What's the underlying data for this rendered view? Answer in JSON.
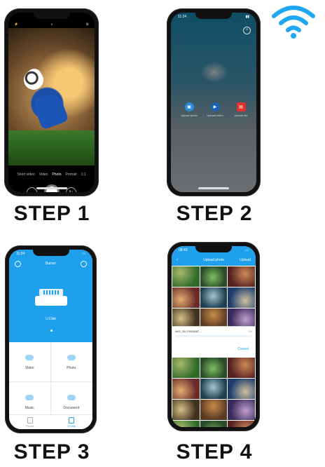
{
  "steps": [
    "STEP 1",
    "STEP 2",
    "STEP 3",
    "STEP 4"
  ],
  "wifi_icon": "wifi-icon",
  "colors": {
    "accent": "#1fa0ec",
    "wifi": "#1ea7f2"
  },
  "step1": {
    "camera_modes": [
      "Short video",
      "Video",
      "Photo",
      "Portrait",
      "1:1"
    ],
    "active_mode": "Photo"
  },
  "step2": {
    "time": "11:24",
    "options": [
      {
        "label": "Upload photo",
        "icon": "image-icon",
        "color": "#2b8bd9"
      },
      {
        "label": "Upload video",
        "icon": "play-icon",
        "color": "#1a66b3"
      },
      {
        "label": "Upload file",
        "icon": "file-icon",
        "color": "#e0322c"
      }
    ]
  },
  "step3": {
    "time": "11:24",
    "title": "Burner",
    "device_name": "U Disk",
    "grid": [
      "Video",
      "Photo",
      "Music",
      "Document"
    ],
    "tabs": [
      "Phone",
      "U Disk"
    ]
  },
  "step4": {
    "time": "08:43",
    "nav_title": "Upload photo",
    "nav_action": "Upload",
    "dialog": {
      "filename": "IMG_20170928087...",
      "percent": "0%",
      "progress": 0,
      "cancel": "Cancel"
    }
  }
}
